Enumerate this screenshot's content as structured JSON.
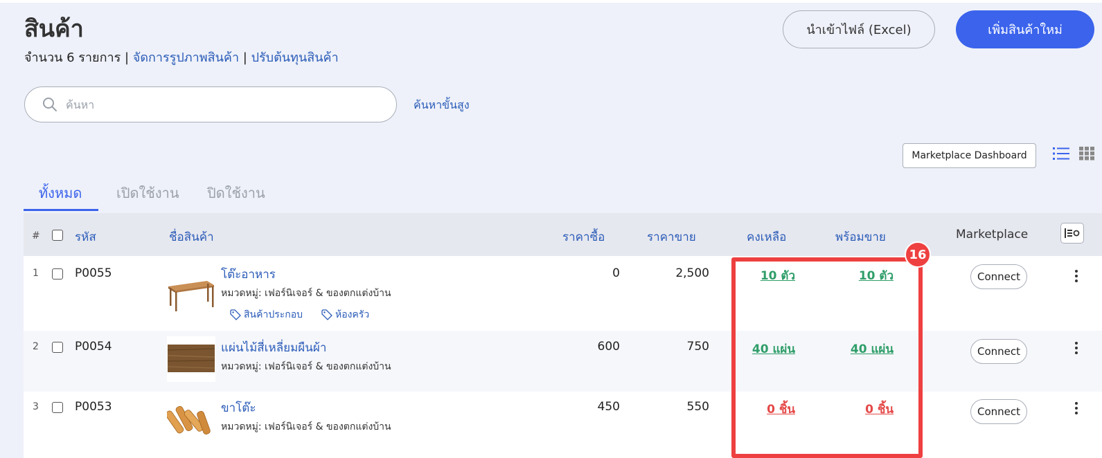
{
  "header": {
    "title": "สินค้า",
    "count_text": "จำนวน 6 รายการ",
    "separator": " | ",
    "link_manage_images": "จัดการรูปภาพสินค้า",
    "link_adjust_cost": "ปรับต้นทุนสินค้า",
    "import_button": "นำเข้าไฟล์ (Excel)",
    "add_button": "เพิ่มสินค้าใหม่"
  },
  "search": {
    "placeholder": "ค้นหา",
    "advanced_label": "ค้นหาขั้นสูง"
  },
  "toolbar": {
    "marketplace_dashboard": "Marketplace Dashboard",
    "list_view_icon": "list-view-icon",
    "grid_view_icon": "grid-view-icon"
  },
  "tabs": [
    {
      "label": "ทั้งหมด",
      "active": true
    },
    {
      "label": "เปิดใช้งาน",
      "active": false
    },
    {
      "label": "ปิดใช้งาน",
      "active": false
    }
  ],
  "table": {
    "headers": {
      "num": "#",
      "code": "รหัส",
      "name": "ชื่อสินค้า",
      "buy_price": "ราคาซื้อ",
      "sell_price": "ราคาขาย",
      "remaining": "คงเหลือ",
      "ready": "พร้อมขาย",
      "marketplace": "Marketplace"
    },
    "rows": [
      {
        "num": "1",
        "code": "P0055",
        "name": "โต๊ะอาหาร",
        "category": "หมวดหมู่: เฟอร์นิเจอร์ & ของตกแต่งบ้าน",
        "tags": [
          "สินค้าประกอบ",
          "ห้องครัว"
        ],
        "buy_price": "0",
        "sell_price": "2,500",
        "remaining": "10 ตัว",
        "ready": "10 ตัว",
        "stock_status": "in-stock",
        "connect": "Connect",
        "thumbnail": "dining-table"
      },
      {
        "num": "2",
        "code": "P0054",
        "name": "แผ่นไม้สี่เหลี่ยมผืนผ้า",
        "category": "หมวดหมู่: เฟอร์นิเจอร์ & ของตกแต่งบ้าน",
        "tags": [],
        "buy_price": "600",
        "sell_price": "750",
        "remaining": "40 แผ่น",
        "ready": "40 แผ่น",
        "stock_status": "in-stock",
        "connect": "Connect",
        "thumbnail": "wood-board"
      },
      {
        "num": "3",
        "code": "P0053",
        "name": "ขาโต๊ะ",
        "category": "หมวดหมู่: เฟอร์นิเจอร์ & ของตกแต่งบ้าน",
        "tags": [],
        "buy_price": "450",
        "sell_price": "550",
        "remaining": "0 ชิ้น",
        "ready": "0 ชิ้น",
        "stock_status": "out-of-stock",
        "connect": "Connect",
        "thumbnail": "table-legs"
      }
    ]
  },
  "annotation": {
    "badge_number": "16",
    "color": "#ee4040"
  },
  "colors": {
    "accent": "#3b63ec",
    "link": "#2a5bb8",
    "in_stock": "#2f9e69",
    "out_of_stock": "#e54848",
    "background": "#eef1f9"
  }
}
